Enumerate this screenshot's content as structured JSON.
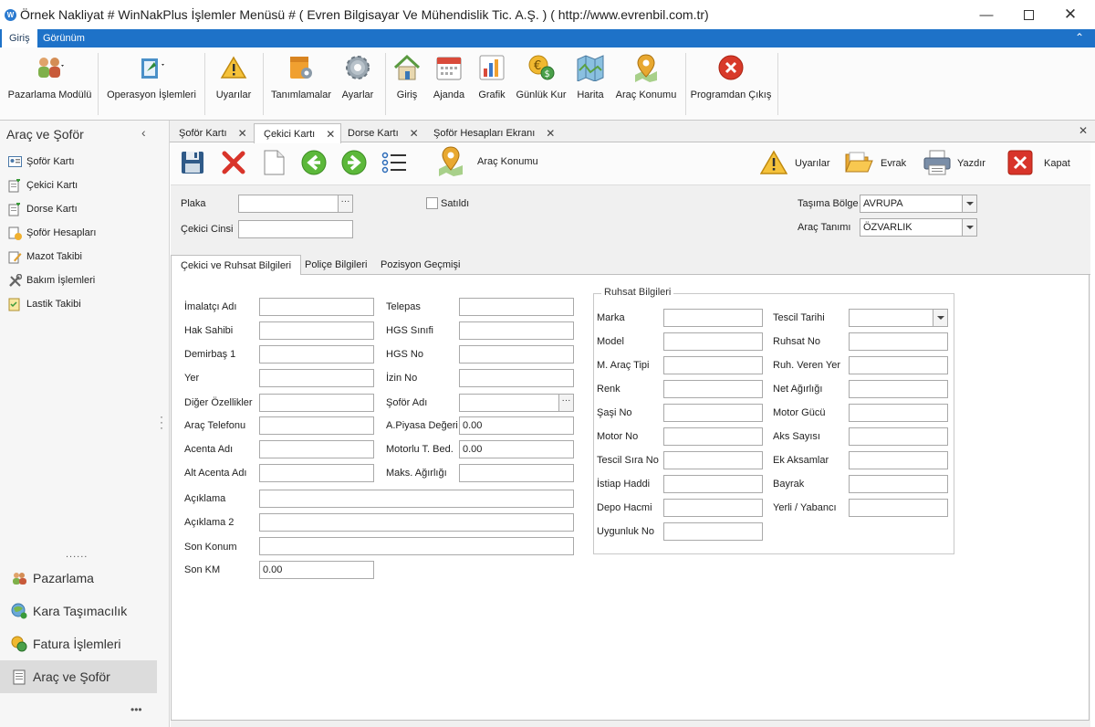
{
  "window": {
    "title": "Örnek Nakliyat # WinNakPlus İşlemler Menüsü #  ( Evren Bilgisayar Ve Mühendislik Tic. A.Ş. ) ( http://www.evrenbil.com.tr)",
    "icon_text": "W"
  },
  "menu": {
    "tabs": [
      "Giriş",
      "Görünüm"
    ]
  },
  "ribbon": {
    "buttons": [
      "Pazarlama Modülü",
      "Operasyon İşlemleri",
      "Uyarılar",
      "Tanımlamalar",
      "Ayarlar",
      "Giriş",
      "Ajanda",
      "Grafik",
      "Günlük Kur",
      "Harita",
      "Araç Konumu",
      "Programdan Çıkış"
    ]
  },
  "nav": {
    "title": "Araç ve Şoför",
    "items": [
      "Şoför Kartı",
      "Çekici Kartı",
      "Dorse Kartı",
      "Şoför Hesapları",
      "Mazot Takibi",
      "Bakım İşlemleri",
      "Lastik Takibi"
    ],
    "dots": "......",
    "groups": [
      "Pazarlama",
      "Kara Taşımacılık",
      "Fatura İşlemleri",
      "Araç ve Şoför"
    ],
    "more": "•••"
  },
  "doc_tabs": [
    "Şoför Kartı",
    "Çekici Kartı",
    "Dorse Kartı",
    "Şoför Hesapları Ekranı"
  ],
  "toolbar": {
    "arac_konumu": "Araç Konumu",
    "uyarilar": "Uyarılar",
    "evrak": "Evrak",
    "yazdir": "Yazdır",
    "kapat": "Kapat"
  },
  "header_form": {
    "plaka_label": "Plaka",
    "cekici_cinsi_label": "Çekici Cinsi",
    "satildi_label": "Satıldı",
    "tasima_bolge_label": "Taşıma Bölge",
    "tasima_bolge_value": "AVRUPA",
    "arac_tanimi_label": "Araç Tanımı",
    "arac_tanimi_value": "ÖZVARLIK"
  },
  "form_tabs": [
    "Çekici ve Ruhsat Bilgileri",
    "Poliçe Bilgileri",
    "Pozisyon Geçmişi"
  ],
  "cekici": {
    "left_labels": [
      "İmalatçı Adı",
      "Hak Sahibi",
      "Demirbaş 1",
      "Yer",
      "Diğer Özellikler",
      "Araç Telefonu",
      "Acenta Adı",
      "Alt Acenta Adı"
    ],
    "mid_labels": [
      "Telepas",
      "HGS Sınıfi",
      "HGS No",
      "İzin No",
      "Şoför Adı",
      "A.Piyasa Değeri",
      "Motorlu T. Bed.",
      "Maks. Ağırlığı"
    ],
    "mid_values": [
      "",
      "",
      "",
      "",
      "",
      "0.00",
      "0.00",
      ""
    ],
    "aciklama_label": "Açıklama",
    "aciklama2_label": "Açıklama 2",
    "son_konum_label": "Son Konum",
    "son_km_label": "Son KM",
    "son_km_value": "0.00"
  },
  "ruhsat": {
    "title": "Ruhsat Bilgileri",
    "left_labels": [
      "Marka",
      "Model",
      "M. Araç Tipi",
      "Renk",
      "Şaşi No",
      "Motor No",
      "Tescil Sıra No",
      "İstiap Haddi",
      "Depo Hacmi",
      "Uygunluk No"
    ],
    "right_labels": [
      "Tescil Tarihi",
      "Ruhsat No",
      "Ruh. Veren Yer",
      "Net Ağırlığı",
      "Motor Gücü",
      "Aks Sayısı",
      "Ek Aksamlar",
      "Bayrak",
      "Yerli / Yabancı"
    ]
  }
}
